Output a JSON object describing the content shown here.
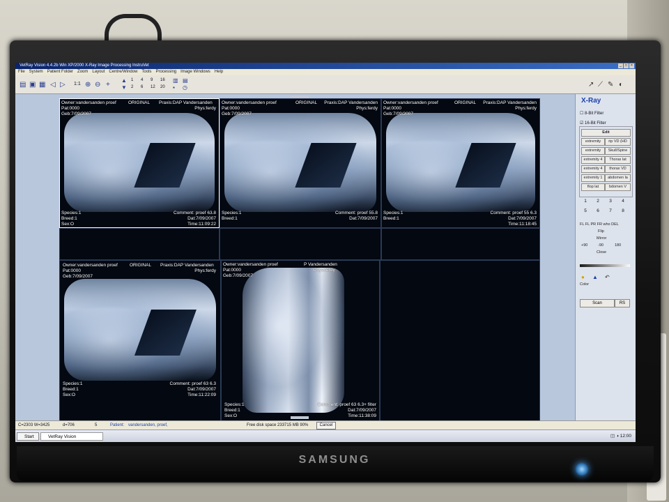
{
  "app": {
    "window_title": "VetRay Vision 4.4.2b Win XP/2000   X-Ray Image Processing   InstruVet",
    "menu": [
      "File",
      "System",
      "Patient Folder",
      "Zoom",
      "Layout",
      "Centre/Window",
      "Tools",
      "Processing",
      "Image Windows",
      "Help"
    ]
  },
  "toolbar": {
    "zoom_label": "1:1",
    "layout_row1": [
      "1",
      "4",
      "9",
      "16"
    ],
    "layout_row2": [
      "2",
      "6",
      "12",
      "20"
    ]
  },
  "tiles": [
    {
      "owner": "Owner:vandersanden proef",
      "tag": "ORIGINAL",
      "praxis": "Praxis:DAP Vandersanden",
      "pat": "Pat:0000",
      "phys": "Phys:ferdy",
      "geb": "Geb:7/09/2007",
      "species": "Species:1",
      "breed": "Breed:1",
      "sex": "Sex:O",
      "comment": "Comment: proef 63.8",
      "dat": "Dat:7/09/2007",
      "time": "Time:11:09:22"
    },
    {
      "owner": "Owner:vandersanden proef",
      "tag": "ORIGINAL",
      "praxis": "Praxis:DAP Vandersanden",
      "pat": "Pat:0000",
      "phys": "Phys:ferdy",
      "geb": "Geb:7/09/2007",
      "species": "Species:1",
      "breed": "Breed:1",
      "sex": "",
      "comment": "Comment: proef 55.8",
      "dat": "Dat:7/09/2007",
      "time": ""
    },
    {
      "owner": "Owner:vandersanden proef",
      "tag": "ORIGINAL",
      "praxis": "Praxis:DAP Vandersanden",
      "pat": "Pat:0000",
      "phys": "Phys:ferdy",
      "geb": "Geb:7/09/2007",
      "species": "Species:1",
      "breed": "Breed:1",
      "sex": "",
      "comment": "Comment: proef 55 6.3",
      "dat": "Dat:7/09/2007",
      "time": "Time:11:18:45"
    },
    {
      "owner": "Owner:vandersanden proef",
      "tag": "ORIGINAL",
      "praxis": "Praxis:DAP Vandersanden",
      "pat": "Pat:0000",
      "phys": "Phys:ferdy",
      "geb": "Geb:7/09/2007",
      "species": "Species:1",
      "breed": "Breed:1",
      "sex": "Sex:O",
      "comment": "Comment: proef 63 6.3",
      "dat": "Dat:7/09/2007",
      "time": "Time:11:22:09"
    },
    {
      "owner": "Owner:vandersanden proef",
      "tag": "",
      "praxis": "P Vandersanden",
      "pat": "Pat:0000",
      "phys": "Phys:ferdy",
      "geb": "Geb:7/09/2007",
      "species": "Species:1",
      "breed": "Breed:1",
      "sex": "Sex:O",
      "comment": "Comment: proef 63 6.3+ filter",
      "dat": "Dat:7/09/2007",
      "time": "Time:11:38:09"
    }
  ],
  "panel": {
    "title": "X-Ray",
    "filter8": "8-Bit Filter",
    "filter16": "16-Bit Filter",
    "edit": "Edit",
    "filter_buttons": [
      [
        "extremity",
        "rip VD (HD"
      ],
      [
        "extremity",
        "Skull/Spine"
      ],
      [
        "extremity 4",
        "Thorax lat"
      ],
      [
        "extremity 4",
        "thorax VD"
      ],
      [
        "extremity 1",
        "abdomen la"
      ],
      [
        "flop lat",
        "bdomen V"
      ]
    ],
    "numbers_row1": [
      "1",
      "2",
      "3",
      "4"
    ],
    "numbers_row2": [
      "5",
      "6",
      "7",
      "8"
    ],
    "flip_labels": "FL FL  PR  FR  who DEL",
    "flip": "Flip",
    "mirror": "Mirror",
    "rotations": [
      "+90",
      "-90",
      "180"
    ],
    "close": "Close",
    "color": "Color",
    "scan": "Scan",
    "rs": "RS"
  },
  "status": {
    "coords": "C=2303 W=3425",
    "d": "d=706",
    "num": "5",
    "patient_label": "Patient:",
    "patient_value": "vandersanden, proef,",
    "disk": "Free disk space 233715 MB 90%",
    "cancel": "Cancel"
  },
  "taskbar": {
    "start": "Start",
    "task": "VetRay Vision",
    "clock": "12:00"
  },
  "monitor": {
    "brand": "SAMSUNG"
  }
}
